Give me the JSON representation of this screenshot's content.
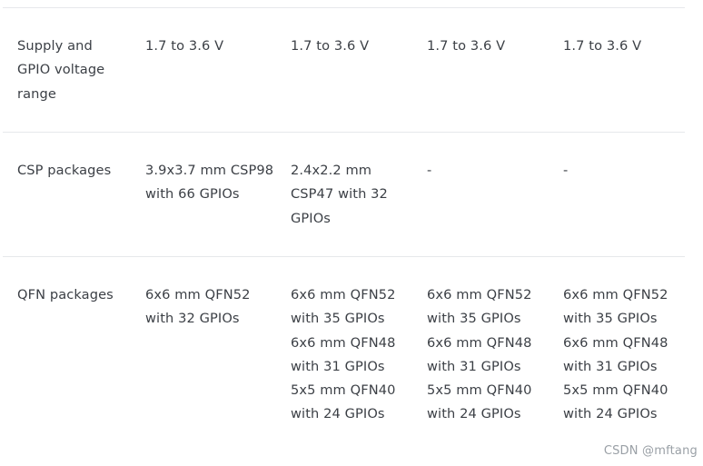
{
  "table": {
    "rows": [
      {
        "label": "Supply and GPIO voltage range",
        "cells": [
          "1.7 to 3.6 V",
          "1.7 to 3.6 V",
          "1.7 to 3.6 V",
          "1.7 to 3.6 V"
        ]
      },
      {
        "label": "CSP packages",
        "cells": [
          "3.9x3.7 mm CSP98 with 66 GPIOs",
          "2.4x2.2 mm CSP47 with 32 GPIOs",
          "-",
          "-"
        ]
      },
      {
        "label": "QFN packages",
        "cells": [
          "6x6 mm QFN52 with 32 GPIOs",
          "6x6 mm QFN52 with 35 GPIOs 6x6 mm QFN48 with 31 GPIOs 5x5 mm QFN40 with 24 GPIOs",
          "6x6 mm QFN52 with 35 GPIOs 6x6 mm QFN48 with 31 GPIOs 5x5 mm QFN40 with 24 GPIOs",
          "6x6 mm QFN52 with 35 GPIOs 6x6 mm QFN48 with 31 GPIOs 5x5 mm QFN40 with 24 GPIOs"
        ]
      }
    ]
  },
  "watermark": "CSDN @mftang"
}
